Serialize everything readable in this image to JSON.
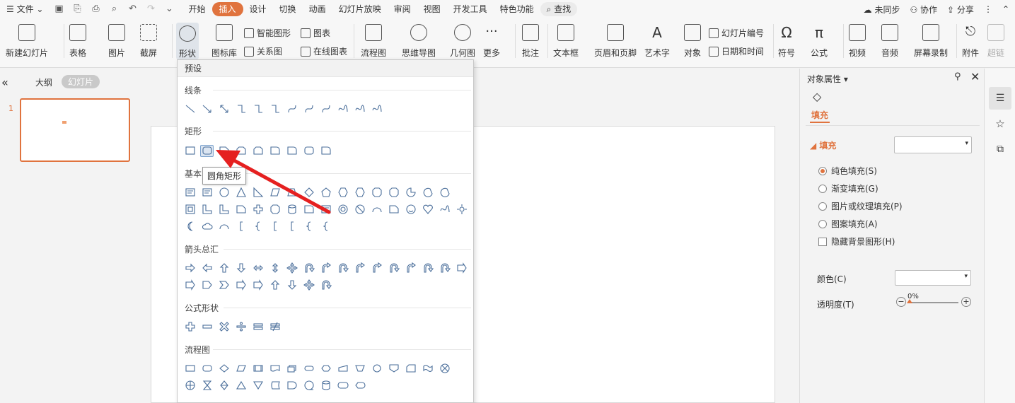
{
  "menubar": {
    "hamburger": "☰",
    "file": "文件",
    "items": [
      "开始",
      "插入",
      "设计",
      "切换",
      "动画",
      "幻灯片放映",
      "审阅",
      "视图",
      "开发工具",
      "特色功能"
    ],
    "search": "查找",
    "unsynced": "未同步",
    "collab": "协作",
    "share": "分享"
  },
  "ribbon": {
    "new_slide": "新建幻灯片",
    "table": "表格",
    "picture": "图片",
    "screenshot": "截屏",
    "shape": "形状",
    "icon_lib": "图标库",
    "smart_graphic": "智能图形",
    "chart": "图表",
    "relation": "关系图",
    "online_chart": "在线图表",
    "flowchart": "流程图",
    "mindmap": "思维导图",
    "geometry": "几何图",
    "more": "更多",
    "comment": "批注",
    "textbox": "文本框",
    "header_footer": "页眉和页脚",
    "art_text": "艺术字",
    "object": "对象",
    "slide_number": "幻灯片编号",
    "datetime": "日期和时间",
    "symbol": "符号",
    "formula": "公式",
    "video": "视频",
    "audio": "音频",
    "screen_record": "屏幕录制",
    "attachment": "附件",
    "hyperlink": "超链"
  },
  "leftpane": {
    "outline": "大纲",
    "slides": "幻灯片",
    "slide_no": "1"
  },
  "dropdown": {
    "title": "预设",
    "sections": [
      "线条",
      "矩形",
      "基本",
      "箭头总汇",
      "公式形状",
      "流程图"
    ],
    "tooltip": "圆角矩形"
  },
  "props": {
    "title": "对象属性",
    "tab_fill": "填充",
    "fill_header": "填充",
    "options": [
      "纯色填充(S)",
      "渐变填充(G)",
      "图片或纹理填充(P)",
      "图案填充(A)"
    ],
    "hide_bg": "隐藏背景图形(H)",
    "color": "颜色(C)",
    "transparency": "透明度(T)",
    "transparency_value": "0%"
  }
}
